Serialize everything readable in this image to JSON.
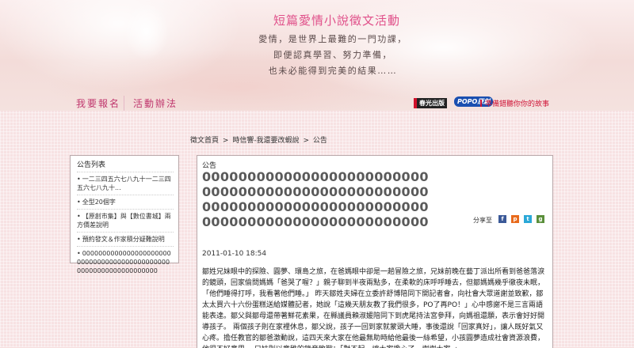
{
  "banner": {
    "title": "短篇愛情小說徵文活動",
    "poem": [
      "愛情，是世界上最難的一門功課，",
      "即便認真學習、努力準備，",
      "也未必能得到完美的結果……"
    ]
  },
  "nav": {
    "signup": "我要報名",
    "rules": "活動辦法"
  },
  "brands": {
    "brand1": "春光出版",
    "brand2": "POPO原創",
    "brand3": "準備錯聽你你的故事"
  },
  "breadcrumb": [
    "徵文首頁",
    ">",
    "時信響-我還要改蝦說",
    ">",
    "公告"
  ],
  "sidebar": {
    "title": "公告列表",
    "items": [
      "一二三四五六七八九十一二三四五六七八九十...",
      "全型20個字",
      "【原創市集】與【數位書城】兩方價差說明",
      "預約發文＆作家積分疑難說明",
      "00000000000000000000000000000000000000000000000000000000000000000"
    ]
  },
  "post": {
    "section": "公告",
    "title": "0000000000000000000000000000000000000000000000000000000000000000000000000000000000000000000000000000",
    "share_label": "分享至",
    "date": "2011-01-10 18:54",
    "body": "鄒姓兄妹眼中的探險、圓夢、環島之旅，在爸媽眼中卻是一趟冒險之旅，兄妹前晚在藝丁派出所看到爸爸落淚的鏡頭，回家偷問媽媽「爸哭了喔？」親子聊到半夜兩點多，在柔軟的床呼呼睡去，但鄒媽媽幾乎徹夜未眠，「他們睡得打呼，我看著他們睡。」 昨天鄒姓夫婦在立委許舒博陪同下開記者會，向社會大眾道謝並致歉，鄒太太買六十六份蛋糕送給媒體記者，她說「這幾天朋友教了我們很多，PO了再PO！」心中感謝不是三言兩語能表達。鄒父與鄒母還帶著鮮花素果，在縣議員賴淑媛陪同下到虎尾持法宮參拜，向媽祖還願，表示會好好開導孩子。 兩個孩子則在家裡休息，鄒父說，孩子一回到家就蒙頭大睡，事後還說「回家真好」，讓人既好氣又心疼。擔任教官的鄒爸激動說，這四天來大家在他最無助時給他最後一絲希望，小孩圓夢造成社會資源浪費，他很不好意思。 兄妹則以童稚的錄音致歉：「對不起，讓大家擔心了，謝謝大家。」"
  },
  "colors": {
    "accent": "#e0508a",
    "share_icons": [
      "#3b5998",
      "#e86a1c",
      "#2ba8d8",
      "#5a8f3a"
    ]
  },
  "icons": [
    "facebook-icon",
    "plurk-icon",
    "twitter-icon",
    "google-icon"
  ]
}
